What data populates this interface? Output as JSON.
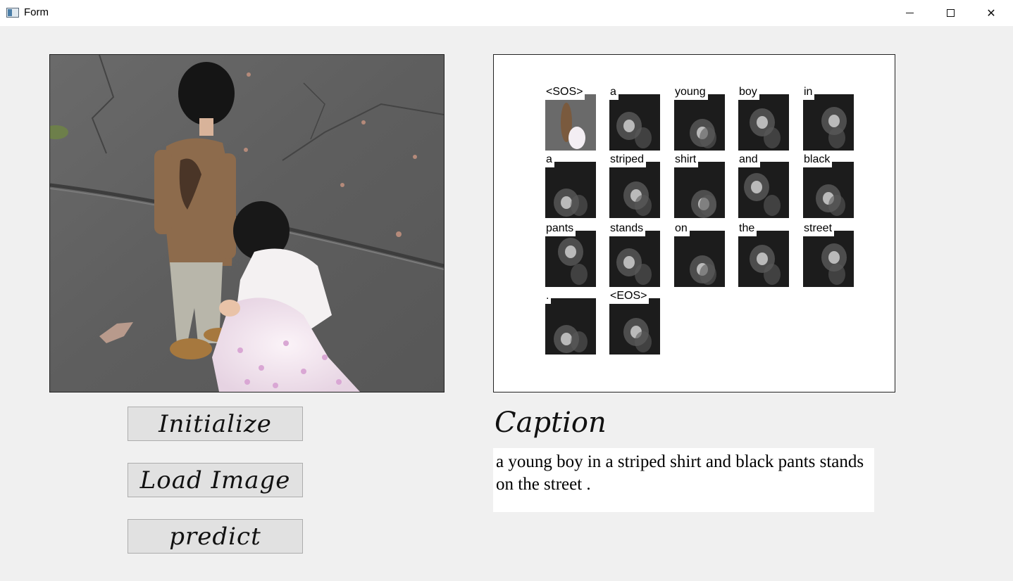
{
  "window": {
    "title": "Form",
    "controls": {
      "minimize": "—",
      "maximize": "☐",
      "close": "✕"
    }
  },
  "buttons": {
    "initialize": "Initialize",
    "load_image": "Load Image",
    "predict": "predict"
  },
  "attention": {
    "tokens": [
      "<SOS>",
      "a",
      "young",
      "boy",
      "in",
      "a",
      "striped",
      "shirt",
      "and",
      "black",
      "pants",
      "stands",
      "on",
      "the",
      "street",
      ".",
      "<EOS>"
    ]
  },
  "caption": {
    "title": "Caption",
    "text": "a young boy in a striped shirt and black pants stands on the street ."
  }
}
